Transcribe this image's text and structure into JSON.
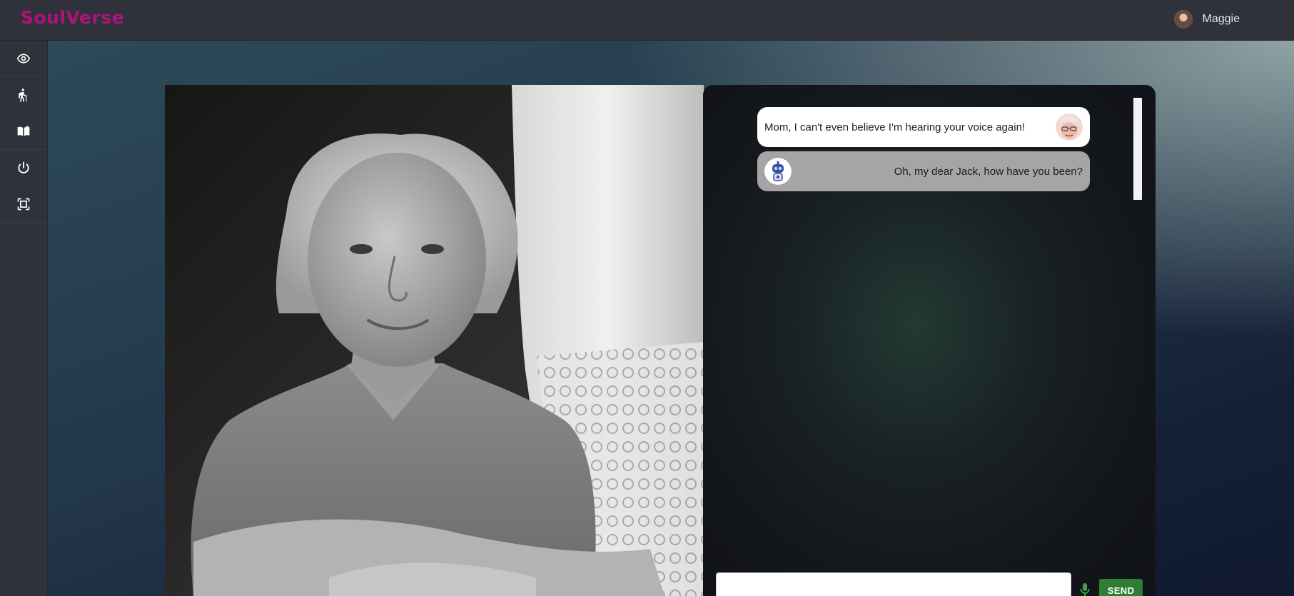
{
  "app": {
    "logo": "SoulVerse"
  },
  "header": {
    "username": "Maggie",
    "avatar_icon": "user-avatar-icon"
  },
  "sidebar": {
    "items": [
      {
        "icon": "eye-icon"
      },
      {
        "icon": "person-walking-cane-icon"
      },
      {
        "icon": "open-book-icon"
      },
      {
        "icon": "power-icon"
      },
      {
        "icon": "fullscreen-frame-icon"
      }
    ]
  },
  "chat": {
    "messages": [
      {
        "sender": "user",
        "text": "Mom, I can't even believe I'm hearing your voice again!",
        "icon": "grandma-avatar-icon"
      },
      {
        "sender": "bot",
        "text": "Oh, my dear Jack, how have you been?",
        "icon": "robot-avatar-icon"
      }
    ],
    "input_value": "",
    "input_placeholder": "",
    "send_label": "SEND"
  },
  "colors": {
    "brand": "#b0127c",
    "send_button": "#2e7d32",
    "mic": "#43a047",
    "user_bubble": "#ffffff",
    "bot_bubble": "#a7a4a6"
  }
}
